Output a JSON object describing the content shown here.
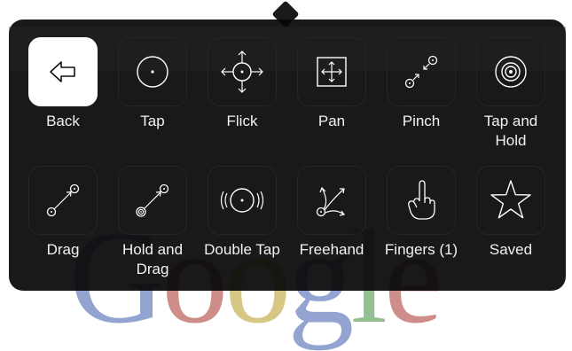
{
  "background": {
    "logo_letters": [
      "G",
      "o",
      "o",
      "g",
      "l",
      "e"
    ]
  },
  "menu": {
    "items": [
      {
        "label": "Back",
        "icon": "arrow-left-icon"
      },
      {
        "label": "Tap",
        "icon": "tap-icon"
      },
      {
        "label": "Flick",
        "icon": "flick-icon"
      },
      {
        "label": "Pan",
        "icon": "pan-icon"
      },
      {
        "label": "Pinch",
        "icon": "pinch-icon"
      },
      {
        "label": "Tap and Hold",
        "icon": "tap-and-hold-icon"
      },
      {
        "label": "Drag",
        "icon": "drag-icon"
      },
      {
        "label": "Hold and Drag",
        "icon": "hold-and-drag-icon"
      },
      {
        "label": "Double Tap",
        "icon": "double-tap-icon"
      },
      {
        "label": "Freehand",
        "icon": "freehand-icon"
      },
      {
        "label": "Fingers (1)",
        "icon": "one-finger-icon"
      },
      {
        "label": "Saved",
        "icon": "star-icon"
      }
    ],
    "selected_label": "Back"
  },
  "colors": {
    "panel_background": "#080808",
    "icon_stroke": "#ffffff",
    "selected_tile": "#ffffff",
    "label_text": "#f2f2f2"
  }
}
